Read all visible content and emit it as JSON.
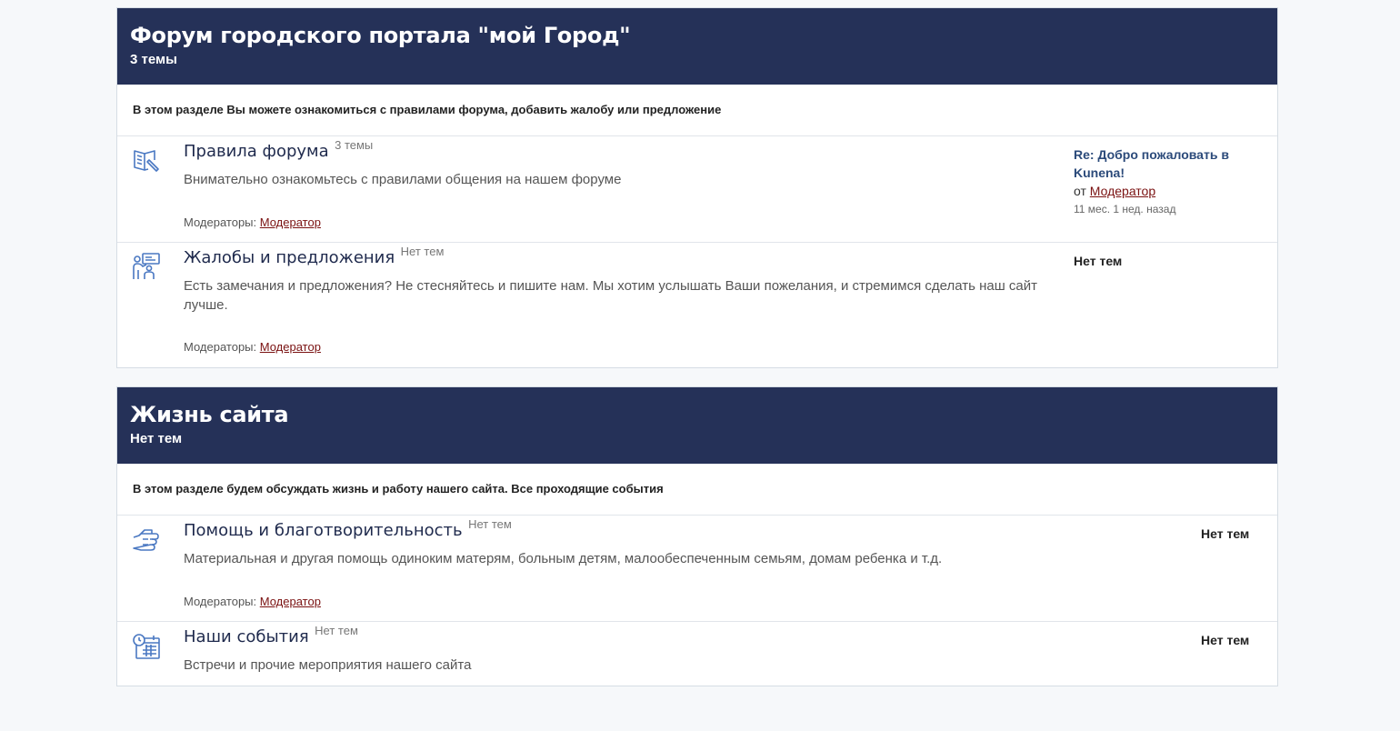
{
  "sections": [
    {
      "title": "Форум городского портала \"мой Город\"",
      "count": "3 темы",
      "description": "В этом разделе Вы можете ознакомиться с правилами форума, добавить жалобу или предложение",
      "categories": [
        {
          "name": "Правила форума",
          "count": "3 темы",
          "description": "Внимательно ознакомьтесь с правилами общения на нашем форуме",
          "moderators_label": "Модераторы:",
          "moderator": "Модератор",
          "last_topic": "Re: Добро пожаловать в Kunena!",
          "last_by_label": "от",
          "last_by": "Модератор",
          "last_time": "11 мес. 1 нед. назад",
          "icon": "book-pencil-icon"
        },
        {
          "name": "Жалобы и предложения",
          "count": "Нет тем",
          "description": "Есть замечания и предложения? Не стесняйтесь и пишите нам. Мы хотим услышать Ваши пожелания, и стремимся сделать наш сайт лучше.",
          "moderators_label": "Модераторы:",
          "moderator": "Модератор",
          "last": "Нет тем",
          "icon": "people-presentation-icon"
        }
      ]
    },
    {
      "title": "Жизнь сайта",
      "count": "Нет тем",
      "description": "В этом разделе будем обсуждать жизнь и работу нашего сайта. Все проходящие события",
      "categories": [
        {
          "name": "Помощь и благотворительность",
          "count": "Нет тем",
          "description": "Материальная и другая помощь одиноким матерям, больным детям, малообеспеченным семьям, домам ребенка и т.д.",
          "moderators_label": "Модераторы:",
          "moderator": "Модератор",
          "last": "Нет тем",
          "icon": "helping-hand-icon"
        },
        {
          "name": "Наши события",
          "count": "Нет тем",
          "description": "Встречи и прочие мероприятия нашего сайта",
          "last": "Нет тем",
          "icon": "calendar-clock-icon"
        }
      ]
    }
  ]
}
